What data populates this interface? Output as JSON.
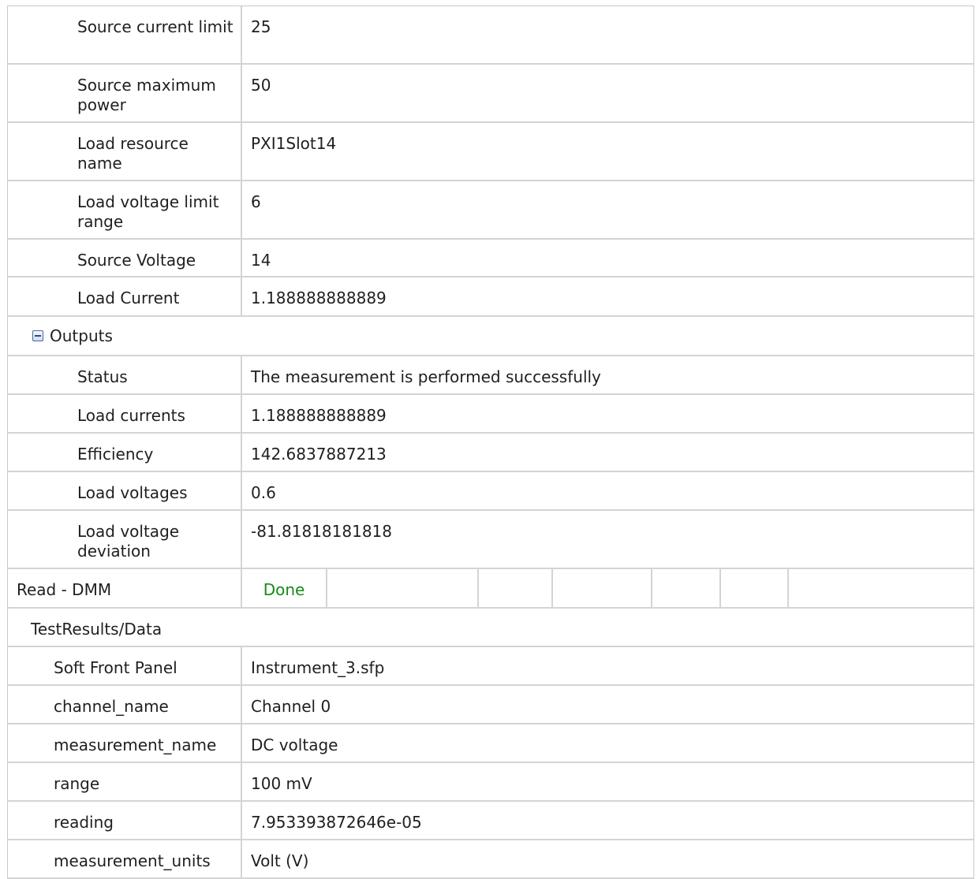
{
  "inputs": [
    {
      "label": "Source current limit",
      "value": "25"
    },
    {
      "label": "Source maximum power",
      "value": "50"
    },
    {
      "label": "Load resource name",
      "value": "PXI1Slot14"
    },
    {
      "label": "Load voltage limit range",
      "value": "6"
    },
    {
      "label": "Source Voltage",
      "value": "14"
    },
    {
      "label": "Load Current",
      "value": "1.188888888889"
    }
  ],
  "outputs": {
    "label": "Outputs",
    "toggle_icon": "collapse-minus-icon",
    "rows": [
      {
        "label": "Status",
        "value": "The measurement is performed successfully"
      },
      {
        "label": "Load currents",
        "value": "1.188888888889"
      },
      {
        "label": "Efficiency",
        "value": "142.6837887213"
      },
      {
        "label": "Load voltages",
        "value": "0.6"
      },
      {
        "label": "Load voltage deviation",
        "value": "-81.81818181818"
      }
    ]
  },
  "step": {
    "name": "Read - DMM",
    "status": "Done",
    "status_color": "#178a17"
  },
  "test_results": {
    "label": "TestResults/Data",
    "rows": [
      {
        "label": "Soft Front Panel",
        "value": "Instrument_3.sfp"
      },
      {
        "label": "channel_name",
        "value": "Channel 0"
      },
      {
        "label": "measurement_name",
        "value": "DC voltage"
      },
      {
        "label": "range",
        "value": "100 mV"
      },
      {
        "label": "reading",
        "value": "7.953393872646e-05"
      },
      {
        "label": "measurement_units",
        "value": "Volt (V)"
      }
    ]
  }
}
